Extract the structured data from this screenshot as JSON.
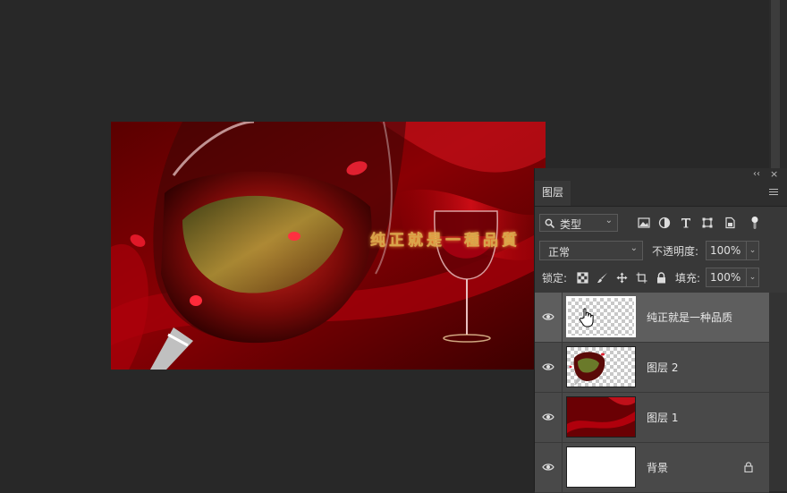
{
  "artwork": {
    "caption": "纯正就是一種品質"
  },
  "panel": {
    "tab_label": "图层",
    "filter": {
      "label": "类型"
    },
    "blend_mode": "正常",
    "opacity_label": "不透明度:",
    "opacity_value": "100%",
    "lock_label": "锁定:",
    "fill_label": "填充:",
    "fill_value": "100%"
  },
  "layers": [
    {
      "name": "纯正就是一种品质",
      "selected": true,
      "thumbnail": "transparent-text",
      "visible": true,
      "locked": false
    },
    {
      "name": "图层 2",
      "selected": false,
      "thumbnail": "wine-glass-cutout",
      "visible": true,
      "locked": false
    },
    {
      "name": "图层 1",
      "selected": false,
      "thumbnail": "red-silk",
      "visible": true,
      "locked": false
    },
    {
      "name": "背景",
      "selected": false,
      "thumbnail": "white",
      "visible": true,
      "locked": true
    }
  ],
  "icons": {
    "visibility": "eye-icon",
    "cursor": "hand-pointer-icon"
  },
  "colors": {
    "app_background": "#282828",
    "panel_background": "#383838",
    "selected_row": "#5e5e5e",
    "caption_gold": "#d8a44a"
  }
}
